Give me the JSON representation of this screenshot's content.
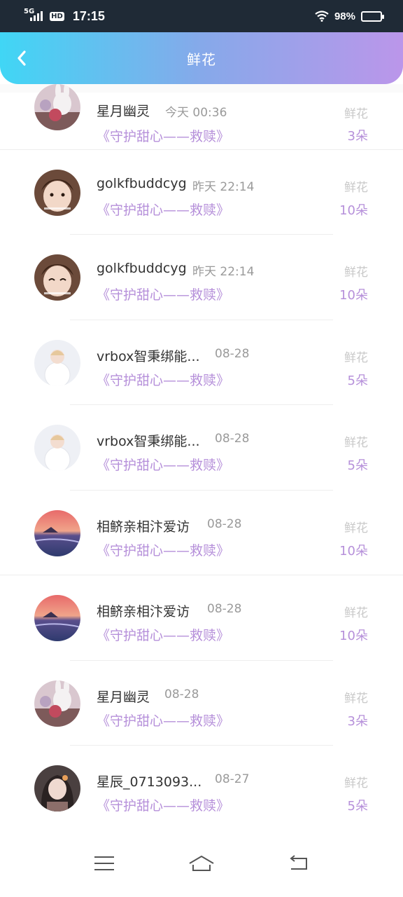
{
  "status_bar": {
    "network": "5G",
    "hd": "HD",
    "time": "17:15",
    "battery": "98%"
  },
  "header": {
    "title": "鲜花",
    "back_icon": "chevron-left-icon"
  },
  "records": [
    {
      "name": "星月幽灵",
      "date": "今天 00:36",
      "gift": "《守护甜心——救赎》",
      "gift_label": "鲜花",
      "count": "3朵",
      "avatar": "rabbit-doll"
    },
    {
      "name": "golkfbuddcyg",
      "date": "昨天 22:14",
      "gift": "《守护甜心——救赎》",
      "gift_label": "鲜花",
      "count": "10朵",
      "avatar": "girl-face"
    },
    {
      "name": "golkfbuddcyg",
      "date": "昨天 22:14",
      "gift": "《守护甜心——救赎》",
      "gift_label": "鲜花",
      "count": "10朵",
      "avatar": "girl-face"
    },
    {
      "name": "vrbox智秉绑能...",
      "date": "08-28",
      "gift": "《守护甜心——救赎》",
      "gift_label": "鲜花",
      "count": "5朵",
      "avatar": "white-dress-child"
    },
    {
      "name": "vrbox智秉绑能...",
      "date": "08-28",
      "gift": "《守护甜心——救赎》",
      "gift_label": "鲜花",
      "count": "5朵",
      "avatar": "white-dress-child"
    },
    {
      "name": "相鲚亲相汴爱访",
      "date": "08-28",
      "gift": "《守护甜心——救赎》",
      "gift_label": "鲜花",
      "count": "10朵",
      "avatar": "sunset-sea"
    },
    {
      "name": "相鲚亲相汴爱访",
      "date": "08-28",
      "gift": "《守护甜心——救赎》",
      "gift_label": "鲜花",
      "count": "10朵",
      "avatar": "sunset-sea"
    },
    {
      "name": "星月幽灵",
      "date": "08-28",
      "gift": "《守护甜心——救赎》",
      "gift_label": "鲜花",
      "count": "3朵",
      "avatar": "rabbit-doll"
    },
    {
      "name": "星辰_0713093...",
      "date": "08-27",
      "gift": "《守护甜心——救赎》",
      "gift_label": "鲜花",
      "count": "5朵",
      "avatar": "anime-girl"
    }
  ],
  "nav_bar": {
    "menu_icon": "menu-icon",
    "home_icon": "home-icon",
    "back_icon": "back-icon"
  },
  "colors": {
    "header_start": "#40d6f5",
    "header_end": "#bb96ea",
    "accent": "#b690da",
    "status_bg": "#1f2a36"
  }
}
